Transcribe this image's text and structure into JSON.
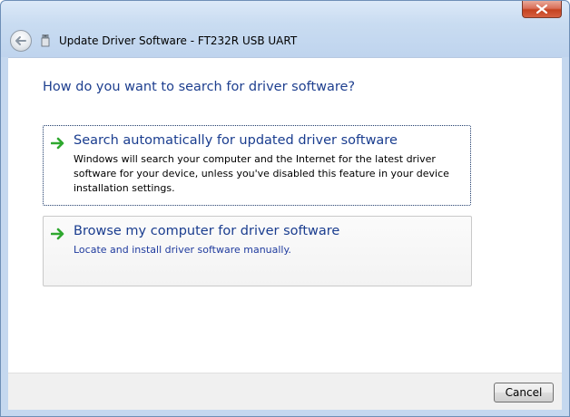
{
  "window": {
    "title": "Update Driver Software - FT232R USB UART",
    "close_icon": "close-icon",
    "back_icon": "back-arrow-icon"
  },
  "main": {
    "heading": "How do you want to search for driver software?",
    "options": [
      {
        "title": "Search automatically for updated driver software",
        "description": "Windows will search your computer and the Internet for the latest driver software for your device, unless you've disabled this feature in your device installation settings.",
        "icon": "green-arrow-icon"
      },
      {
        "title": "Browse my computer for driver software",
        "description": "Locate and install driver software manually.",
        "icon": "green-arrow-icon"
      }
    ]
  },
  "footer": {
    "cancel_label": "Cancel"
  },
  "colors": {
    "heading": "#1e3f8f",
    "link": "#1a3d8f",
    "close": "#c5421f",
    "arrow": "#2fa82f"
  }
}
